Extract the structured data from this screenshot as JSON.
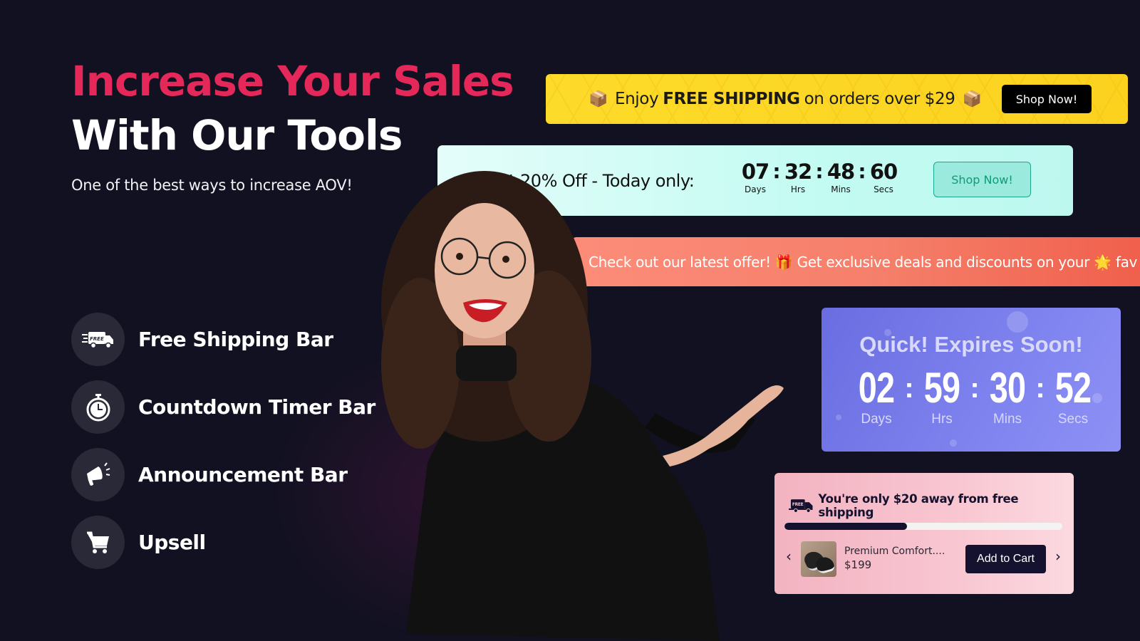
{
  "hero": {
    "title_line1": "Increase Your Sales",
    "title_line2": "With Our Tools",
    "subtitle": "One of the best ways to increase AOV!",
    "accent_color": "#e4285a"
  },
  "features": [
    {
      "label": "Free Shipping Bar",
      "icon": "free-shipping-truck-icon"
    },
    {
      "label": "Countdown Timer Bar",
      "icon": "stopwatch-icon"
    },
    {
      "label": "Announcement Bar",
      "icon": "megaphone-icon"
    },
    {
      "label": "Upsell",
      "icon": "cart-icon"
    }
  ],
  "free_shipping_bar": {
    "prefix": "Enjoy",
    "bold": "FREE SHIPPING",
    "suffix": "on orders over $29",
    "icon": "package-boxes-icon",
    "button_label": "Shop Now!",
    "bg_color": "#fcd823"
  },
  "countdown_bar": {
    "message": "t 20% Off - Today only:",
    "days": "07",
    "hours": "32",
    "minutes": "48",
    "seconds": "60",
    "days_label": "Days",
    "hours_label": "Hrs",
    "minutes_label": "Mins",
    "seconds_label": "Secs",
    "separator": ":",
    "button_label": "Shop Now!",
    "bg_color": "#c6fbf3"
  },
  "announcement_bar": {
    "part1": "Check out our latest offer!",
    "gift_icon": "🎁",
    "part2": "Get exclusive deals and discounts on your",
    "sparkle_icon": "🌟",
    "part3": "fav",
    "bg_color": "#f57f6a"
  },
  "expiry_card": {
    "title": "Quick! Expires Soon!",
    "days": "02",
    "hours": "59",
    "minutes": "30",
    "seconds": "52",
    "days_label": "Days",
    "hours_label": "Hrs",
    "minutes_label": "Mins",
    "seconds_label": "Secs",
    "separator": ":",
    "bg_color": "#7a7eec"
  },
  "upsell_card": {
    "message": "You're only $20 away from free shipping",
    "progress_percent": 44,
    "product_name": "Premium Comfort....",
    "product_price": "$199",
    "add_button_label": "Add to Cart",
    "prev_label": "‹",
    "next_label": "›"
  }
}
